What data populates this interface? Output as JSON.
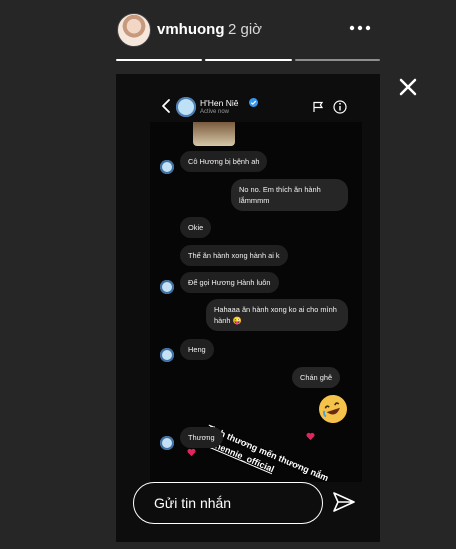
{
  "story": {
    "username": "vmhuong",
    "time": "2 giờ",
    "reply_placeholder": "Gửi tin nhắn",
    "progress_fraction": 0.5
  },
  "dm": {
    "name": "H'Hen Niê",
    "status": "Active now",
    "messages": [
      {
        "side": "in",
        "text": "Cô Hương bị bệnh ah"
      },
      {
        "side": "out",
        "text": "No no. Em thích ăn hành lắmmmm"
      },
      {
        "side": "in",
        "text": "Okie"
      },
      {
        "side": "in",
        "text": "Thế ăn hành xong hành ai k"
      },
      {
        "side": "in",
        "text": "Để gọi Hương Hành luôn"
      },
      {
        "side": "out",
        "text": "Hahaaa ăn hành xong ko ai cho mình hành 😜"
      },
      {
        "side": "in",
        "text": "Heng"
      },
      {
        "side": "out",
        "text": "Chán ghê"
      },
      {
        "side": "in",
        "text": "Thương"
      }
    ]
  },
  "sticker": {
    "line1": "Tình thương mến thương nắm",
    "handle": "@hhennie_official",
    "emoji": "🤣"
  },
  "colors": {
    "background": "#262626",
    "story_background": "#0d0d0d",
    "verified": "#3897f0",
    "heart": "#e0245e"
  }
}
